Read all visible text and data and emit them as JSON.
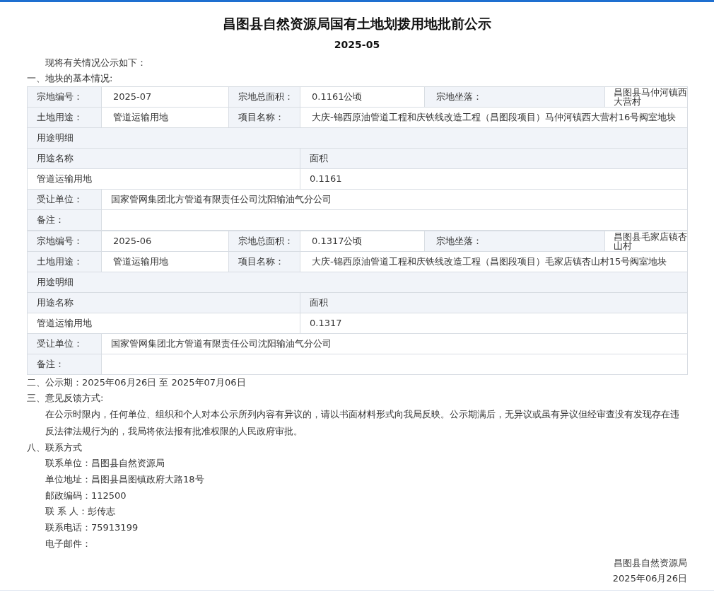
{
  "title": "昌图县自然资源局国有土地划拨用地批前公示",
  "issue": "2025-05",
  "intro": "现将有关情况公示如下：",
  "section_1": "一、地块的基本情况:",
  "parcels": [
    {
      "parcel_no_label": "宗地编号：",
      "parcel_no": "2025-07",
      "area_label": "宗地总面积：",
      "area": "0.1161公顷",
      "location_label": "宗地坐落：",
      "location": "昌图县马仲河镇西大营村",
      "use_label": "土地用途：",
      "use": "管道运输用地",
      "project_label": "项目名称：",
      "project": "大庆-锦西原油管道工程和庆铁线改造工程（昌图段项目）马仲河镇西大营村16号阀室地块",
      "detail_label": "用途明细",
      "detail_name_label": "用途名称",
      "detail_area_label": "面积",
      "detail_name": "管道运输用地",
      "detail_area": "0.1161",
      "assignee_label": "受让单位：",
      "assignee": "国家管网集团北方管道有限责任公司沈阳输油气分公司",
      "remark_label": "备注："
    },
    {
      "parcel_no_label": "宗地编号：",
      "parcel_no": "2025-06",
      "area_label": "宗地总面积：",
      "area": "0.1317公顷",
      "location_label": "宗地坐落：",
      "location": "昌图县毛家店镇杏山村",
      "use_label": "土地用途：",
      "use": "管道运输用地",
      "project_label": "项目名称：",
      "project": "大庆-锦西原油管道工程和庆铁线改造工程（昌图段项目）毛家店镇杏山村15号阀室地块",
      "detail_label": "用途明细",
      "detail_name_label": "用途名称",
      "detail_area_label": "面积",
      "detail_name": "管道运输用地",
      "detail_area": "0.1317",
      "assignee_label": "受让单位：",
      "assignee": "国家管网集团北方管道有限责任公司沈阳输油气分公司",
      "remark_label": "备注："
    }
  ],
  "section_2": "二、公示期：2025年06月26日 至 2025年07月06日",
  "section_3": "三、意见反馈方式:",
  "section_3_text": "在公示时限内，任何单位、组织和个人对本公示所列内容有异议的，请以书面材料形式向我局反映。公示期满后，无异议或虽有异议但经审查没有发现存在违反法律法规行为的，我局将依法报有批准权限的人民政府审批。",
  "section_8": "八、联系方式",
  "contacts": [
    "联系单位：昌图县自然资源局",
    "单位地址：昌图县昌图镇政府大路18号",
    "邮政编码：112500",
    "联 系 人：彭传志",
    "联系电话：75913199",
    "电子邮件："
  ],
  "signature": {
    "org": "昌图县自然资源局",
    "date": "2025年06月26日"
  }
}
